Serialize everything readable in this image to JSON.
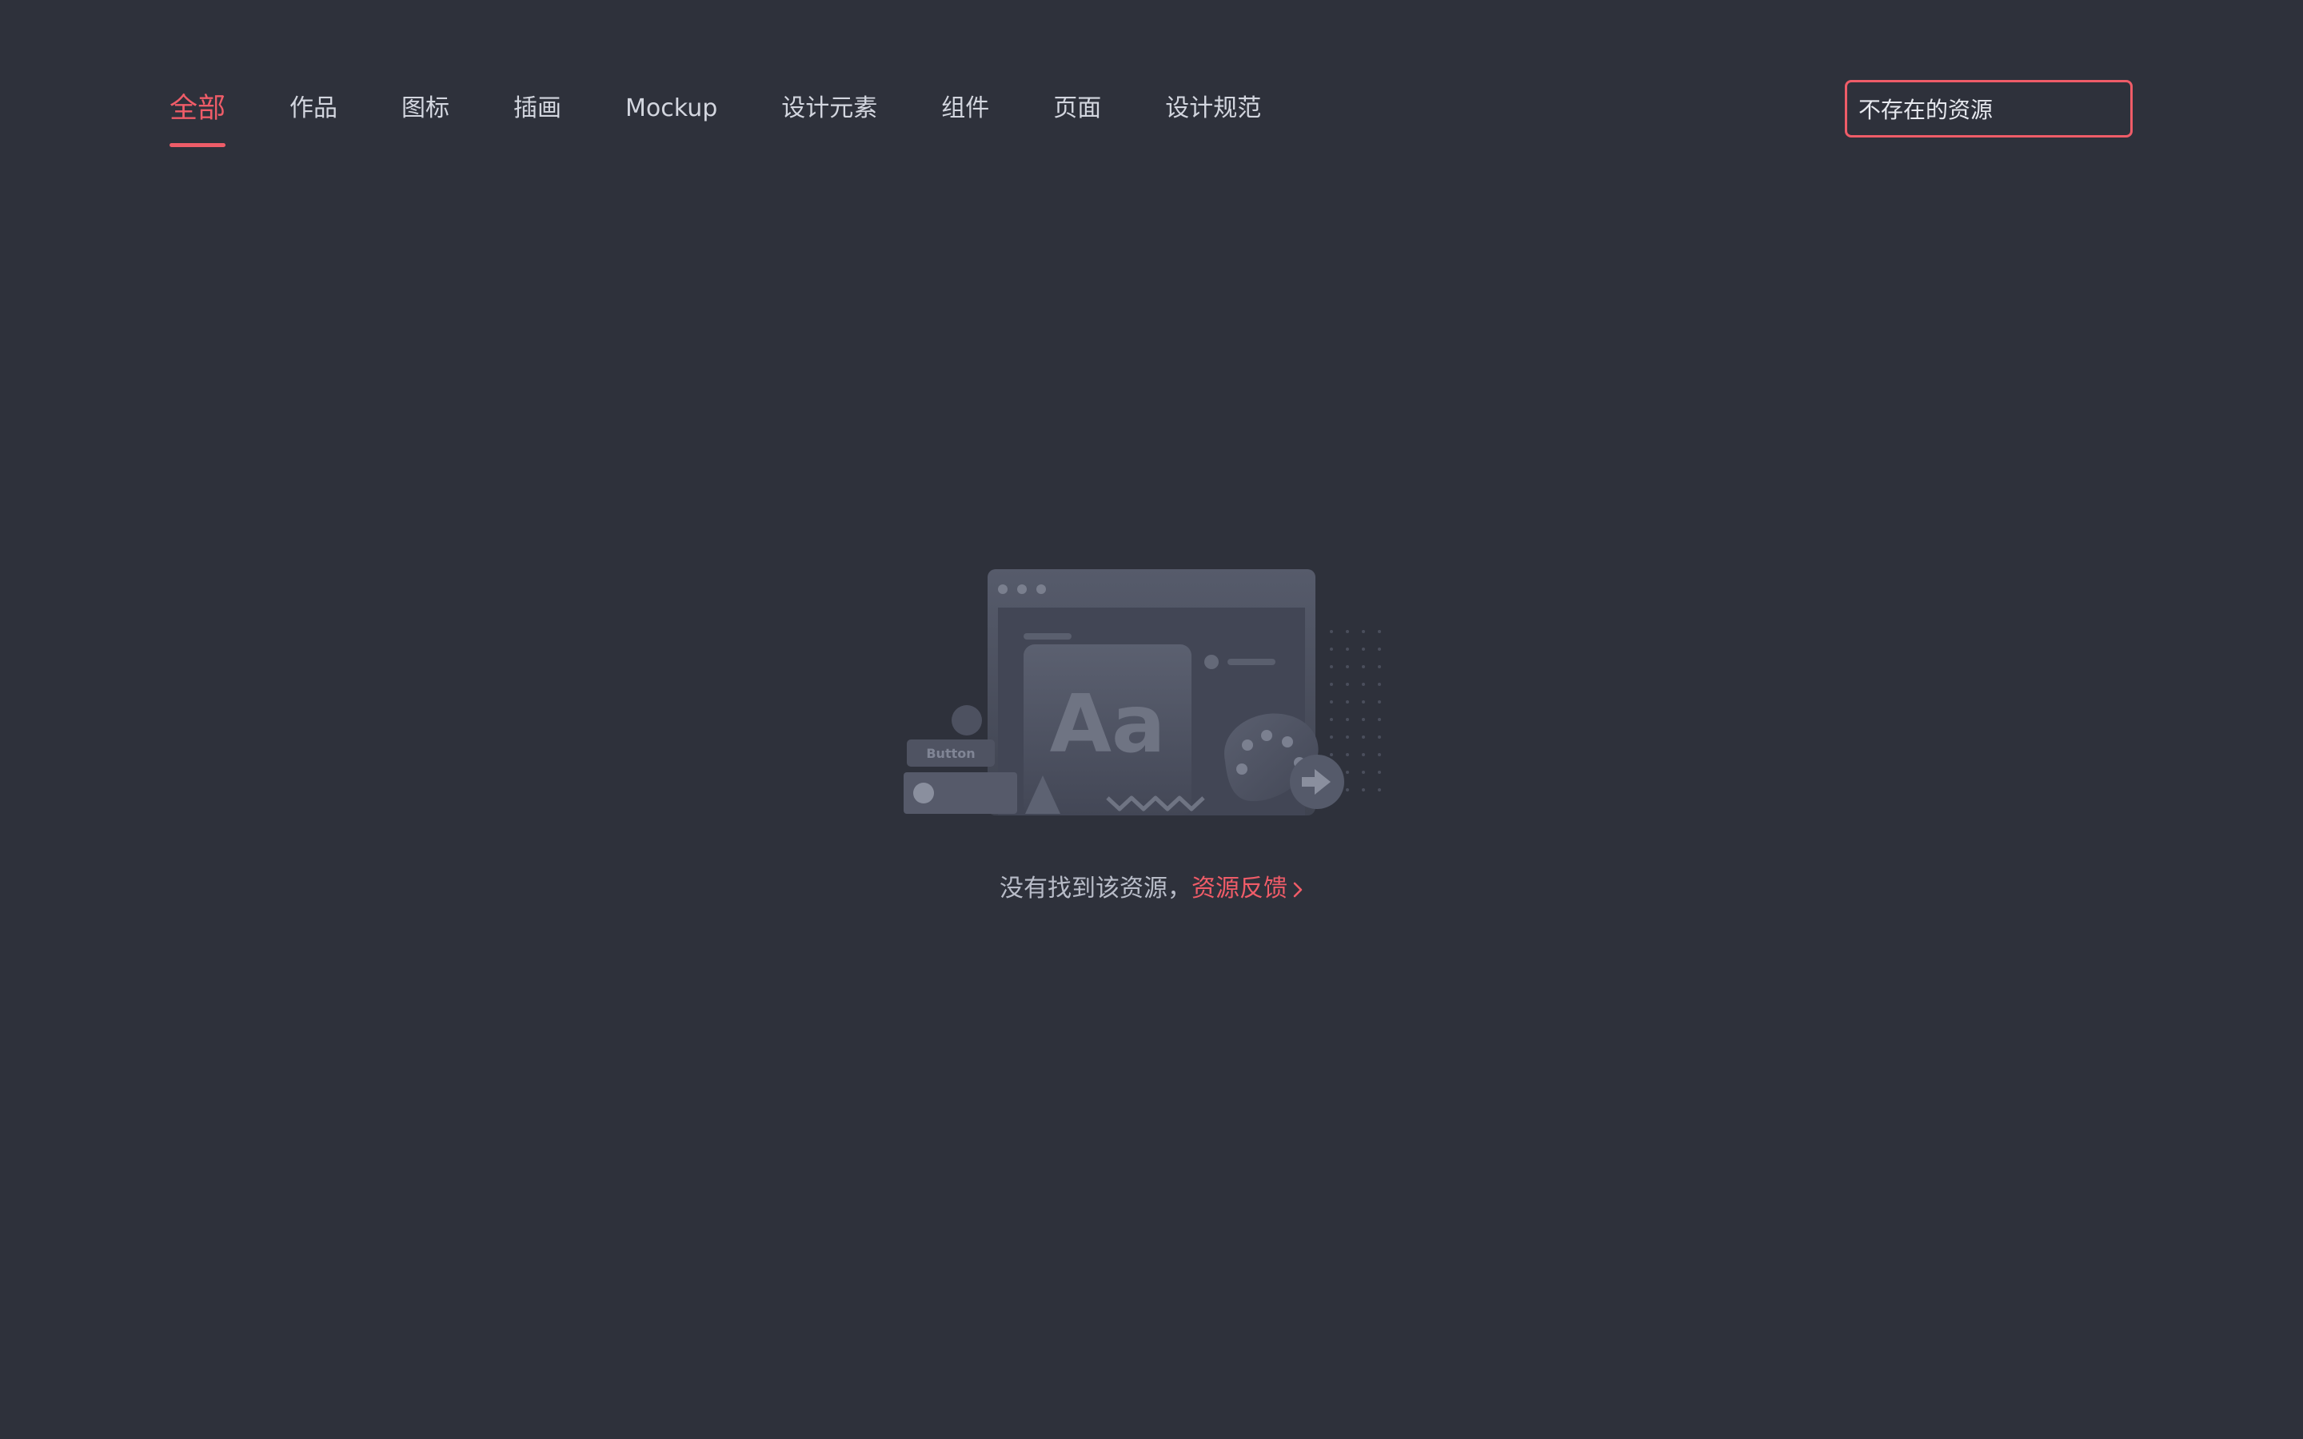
{
  "nav": {
    "tabs": [
      {
        "label": "全部",
        "active": true
      },
      {
        "label": "作品",
        "active": false
      },
      {
        "label": "图标",
        "active": false
      },
      {
        "label": "插画",
        "active": false
      },
      {
        "label": "Mockup",
        "active": false
      },
      {
        "label": "设计元素",
        "active": false
      },
      {
        "label": "组件",
        "active": false
      },
      {
        "label": "页面",
        "active": false
      },
      {
        "label": "设计规范",
        "active": false
      }
    ]
  },
  "search": {
    "value": "不存在的资源",
    "icon": "search-icon"
  },
  "empty": {
    "illustration": {
      "button_text": "Button",
      "font_sample": "Aa"
    },
    "message": "没有找到该资源，",
    "link_label": "资源反馈",
    "link_icon": "chevron-right-icon"
  },
  "colors": {
    "background": "#2e313b",
    "accent": "#ef5c68",
    "text": "#d3d6df",
    "muted_text": "#b8bcc8"
  }
}
